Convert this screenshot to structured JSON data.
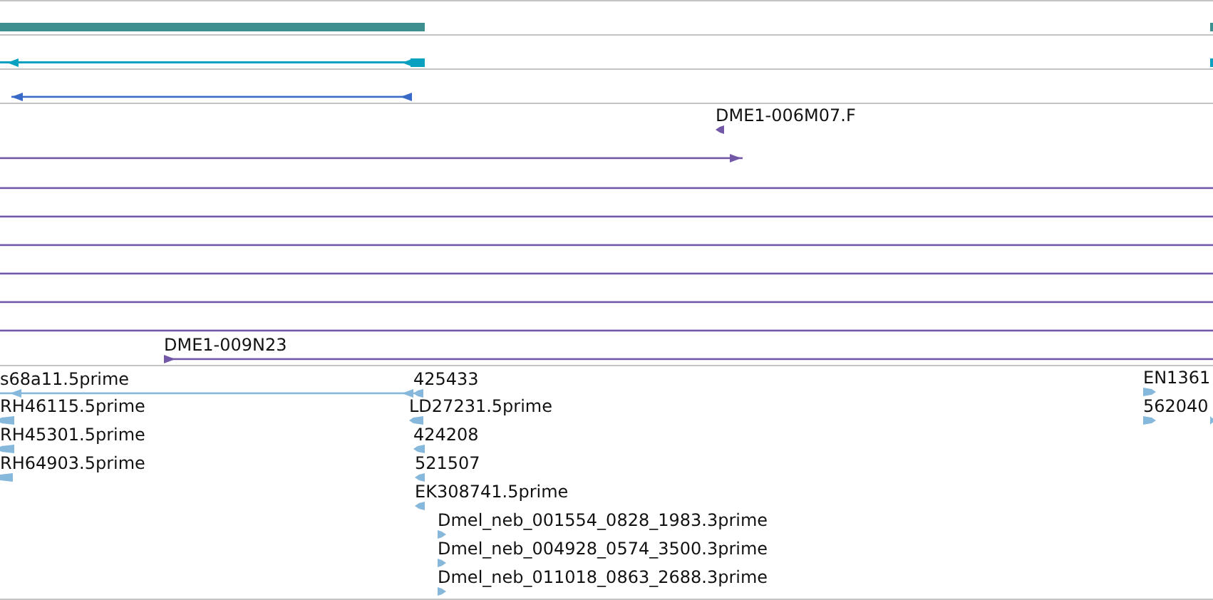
{
  "tracks": [
    {
      "color": "#3f8f8f",
      "features": [
        {
          "kind": "block"
        },
        {
          "kind": "block"
        }
      ]
    },
    {
      "color": "#0aa0c0",
      "features": [
        {
          "kind": "transcript",
          "reverse": true
        },
        {
          "kind": "block"
        }
      ]
    },
    {
      "color": "#3a6ac8",
      "features": [
        {
          "kind": "line",
          "reverse": true
        }
      ]
    },
    {
      "color": "#7458a8",
      "features": [
        {
          "kind": "glyph",
          "reverse": true,
          "label": "DME1-006M07.F"
        },
        {
          "kind": "line",
          "reverse": false
        },
        {
          "kind": "line"
        },
        {
          "kind": "line"
        },
        {
          "kind": "line"
        },
        {
          "kind": "line"
        },
        {
          "kind": "line"
        },
        {
          "kind": "line"
        },
        {
          "kind": "line",
          "reverse": false,
          "label": "DME1-009N23"
        }
      ]
    },
    {
      "color": "#86b8dc",
      "features": [
        {
          "kind": "line",
          "reverse": true,
          "label": "s68a11.5prime"
        },
        {
          "kind": "glyph",
          "reverse": true,
          "label": "RH46115.5prime"
        },
        {
          "kind": "glyph",
          "reverse": true,
          "label": "RH45301.5prime"
        },
        {
          "kind": "glyph",
          "reverse": true,
          "label": "RH64903.5prime"
        },
        {
          "kind": "glyph",
          "reverse": true,
          "label": "425433"
        },
        {
          "kind": "glyph",
          "reverse": true,
          "label": "LD27231.5prime"
        },
        {
          "kind": "glyph",
          "reverse": true,
          "label": "424208"
        },
        {
          "kind": "glyph",
          "reverse": true,
          "label": "521507"
        },
        {
          "kind": "glyph",
          "reverse": true,
          "label": "EK308741.5prime"
        },
        {
          "kind": "glyph",
          "reverse": false,
          "label": "Dmel_neb_001554_0828_1983.3prime"
        },
        {
          "kind": "glyph",
          "reverse": false,
          "label": "Dmel_neb_004928_0574_3500.3prime"
        },
        {
          "kind": "glyph",
          "reverse": false,
          "label": "Dmel_neb_011018_0863_2688.3prime"
        },
        {
          "kind": "glyph",
          "reverse": false,
          "label": "EN1361"
        },
        {
          "kind": "glyph",
          "reverse": false,
          "label": "562040"
        },
        {
          "kind": "glyph",
          "reverse": false
        }
      ]
    }
  ]
}
